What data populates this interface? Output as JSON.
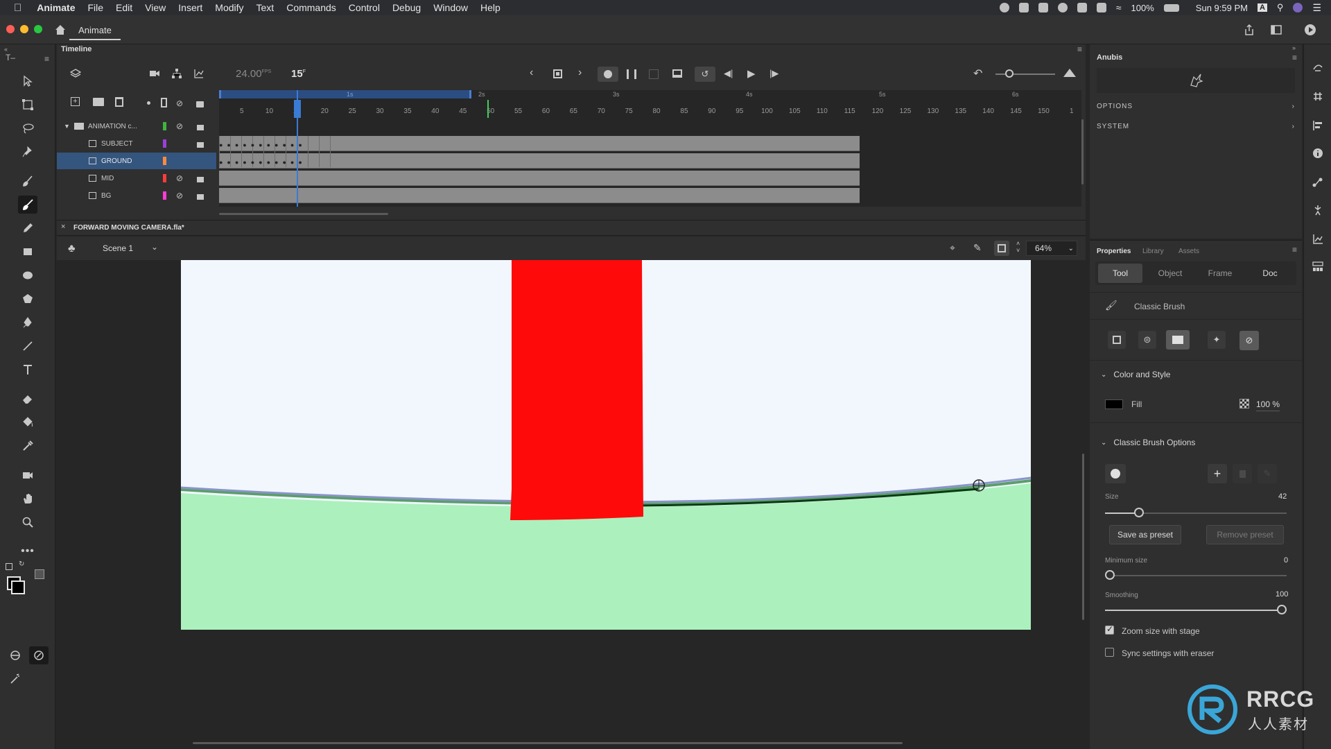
{
  "menubar": {
    "apple": "",
    "items": [
      "Animate",
      "File",
      "Edit",
      "View",
      "Insert",
      "Modify",
      "Text",
      "Commands",
      "Control",
      "Debug",
      "Window",
      "Help"
    ],
    "battery": "100%",
    "clock": "Sun 9:59 PM",
    "input_lang": "A"
  },
  "titlebar": {
    "app_tab": "Animate"
  },
  "timeline": {
    "panel_title": "Timeline",
    "fps": "24.00",
    "fps_unit": "FPS",
    "current_frame": "15",
    "frame_unit": "F",
    "seconds_markers": [
      "1s",
      "2s",
      "3s",
      "4s",
      "5s",
      "6s"
    ],
    "ruler": [
      "5",
      "10",
      "15",
      "20",
      "25",
      "30",
      "35",
      "40",
      "45",
      "50",
      "55",
      "60",
      "65",
      "70",
      "75",
      "80",
      "85",
      "90",
      "95",
      "100",
      "105",
      "110",
      "115",
      "120",
      "125",
      "130",
      "135",
      "140",
      "145",
      "150",
      "1"
    ],
    "layers": [
      {
        "name": "ANIMATION c...",
        "color": "#3fb53f",
        "folder": true
      },
      {
        "name": "SUBJECT",
        "color": "#9b3fd6"
      },
      {
        "name": "GROUND",
        "color": "#ff8a3d",
        "selected": true
      },
      {
        "name": "MID",
        "color": "#ff3b3b"
      },
      {
        "name": "BG",
        "color": "#ff3bd6"
      }
    ]
  },
  "document": {
    "tab_title": "FORWARD MOVING CAMERA.fla*",
    "scene": "Scene 1",
    "zoom": "64%"
  },
  "stage": {
    "sky_color": "#f1f7fd",
    "ground_color": "#acf0bd",
    "pillar_color": "#ff0a0a"
  },
  "anubis": {
    "title": "Anubis",
    "options": "OPTIONS",
    "system": "SYSTEM"
  },
  "properties": {
    "tabs": [
      "Properties",
      "Library",
      "Assets"
    ],
    "subtabs": [
      "Tool",
      "Object",
      "Frame",
      "Doc"
    ],
    "tool_name": "Classic Brush",
    "color_style": {
      "header": "Color and Style",
      "fill_label": "Fill",
      "fill_color": "#000000",
      "alpha": "100 %"
    },
    "brush_options": {
      "header": "Classic Brush Options",
      "size_label": "Size",
      "size_value": "42",
      "save_preset": "Save as preset",
      "remove_preset": "Remove preset",
      "min_size_label": "Minimum size",
      "min_size_value": "0",
      "smoothing_label": "Smoothing",
      "smoothing_value": "100",
      "zoom_size_label": "Zoom size with stage",
      "zoom_size_checked": true,
      "sync_label": "Sync settings with eraser",
      "sync_checked": false
    }
  },
  "watermark": {
    "brand": "RRCG",
    "sub": "人人素材"
  }
}
